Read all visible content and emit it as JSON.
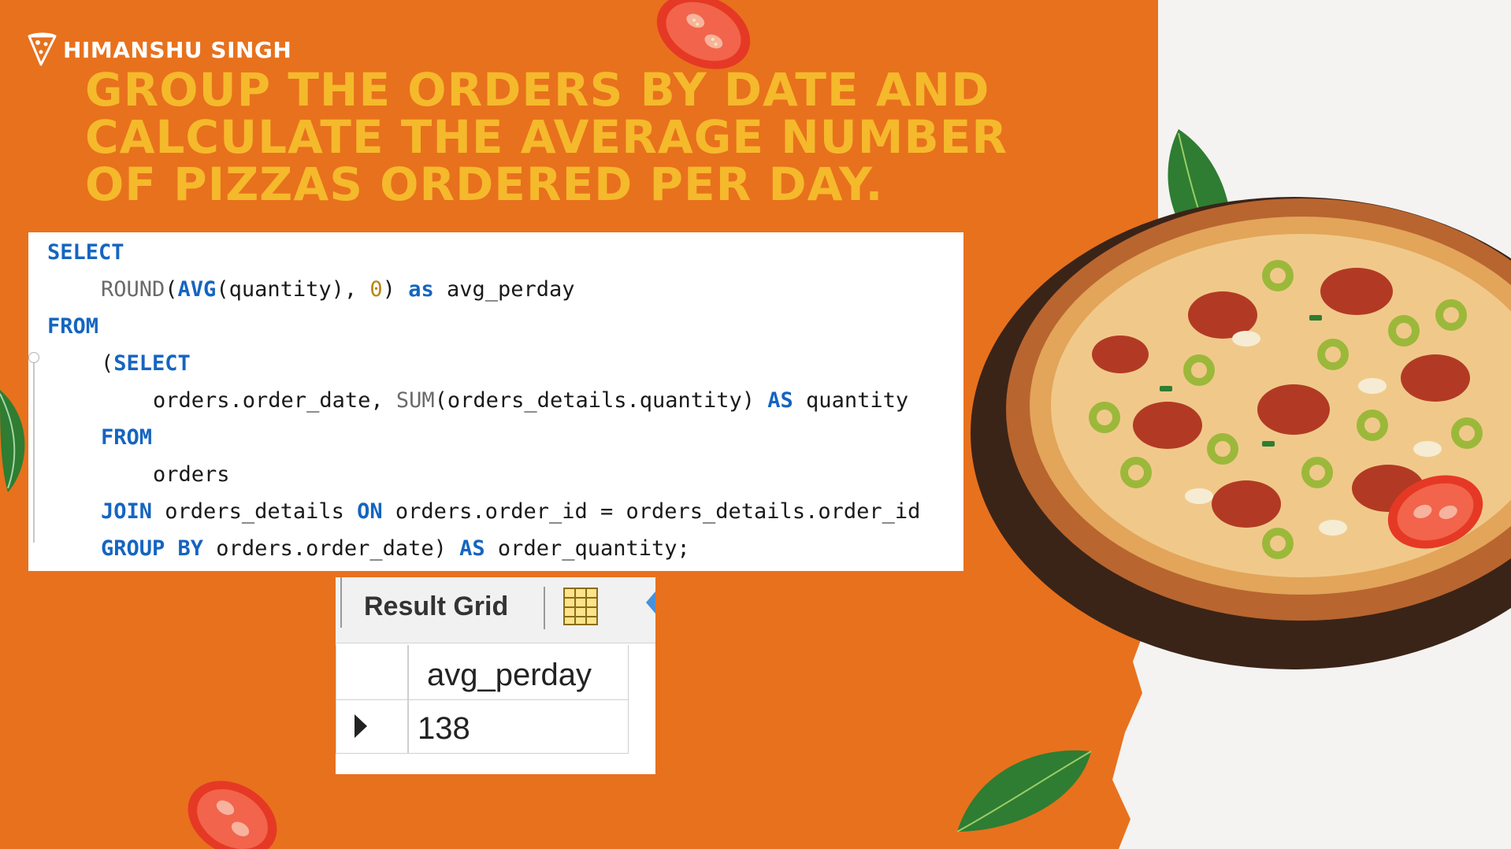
{
  "brand": {
    "name": "HIMANSHU SINGH",
    "icon": "pizza-slice-icon"
  },
  "headline": {
    "lines": [
      "GROUP THE ORDERS BY DATE AND",
      "CALCULATE THE AVERAGE NUMBER",
      "OF PIZZAS ORDERED PER DAY."
    ]
  },
  "code": {
    "l1": {
      "kw": "SELECT"
    },
    "l2": {
      "fn": "ROUND",
      "p1": "(",
      "kw1": "AVG",
      "p2": "(quantity), ",
      "num": "0",
      "p3": ") ",
      "kw2": "as",
      "p4": " avg_perday"
    },
    "l3": {
      "kw": "FROM"
    },
    "l4": {
      "p1": "(",
      "kw": "SELECT"
    },
    "l5": {
      "p1": "orders.order_date, ",
      "fn": "SUM",
      "p2": "(orders_details.quantity) ",
      "kw": "AS",
      "p3": " quantity"
    },
    "l6": {
      "kw": "FROM"
    },
    "l7": {
      "p1": "orders"
    },
    "l8": {
      "kw1": "JOIN",
      "p1": " orders_details ",
      "kw2": "ON",
      "p2": " orders.order_id = orders_details.order_id"
    },
    "l9": {
      "kw1": "GROUP BY",
      "p1": " orders.order_date) ",
      "kw2": "AS",
      "p2": " order_quantity;"
    }
  },
  "result_grid": {
    "title": "Result Grid",
    "toolbar_icons": [
      "grid-view-icon",
      "arrow-icon"
    ],
    "columns": [
      "avg_perday"
    ],
    "rows": [
      [
        "138"
      ]
    ]
  },
  "colors": {
    "background": "#E8711D",
    "headline": "#F5B92C",
    "keyword": "#1565C0",
    "panel_right": "#F4F3F1"
  }
}
